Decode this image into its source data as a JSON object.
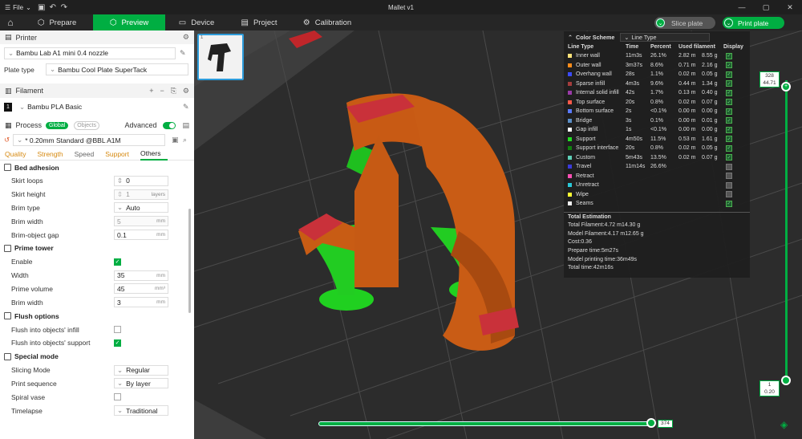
{
  "window": {
    "title": "Mallet v1",
    "menu_label": "File"
  },
  "tabs": [
    {
      "label": "Prepare",
      "icon": "cube-icon"
    },
    {
      "label": "Preview",
      "icon": "cube-icon",
      "active": true
    },
    {
      "label": "Device",
      "icon": "monitor-icon"
    },
    {
      "label": "Project",
      "icon": "project-icon"
    },
    {
      "label": "Calibration",
      "icon": "calibration-icon"
    }
  ],
  "actions": {
    "slice_label": "Slice plate",
    "print_label": "Print plate"
  },
  "printer": {
    "section_title": "Printer",
    "name": "Bambu Lab A1 mini 0.4 nozzle",
    "plate_type_label": "Plate type",
    "plate_type_value": "Bambu Cool Plate SuperTack"
  },
  "filament": {
    "section_title": "Filament",
    "slot": "1",
    "name": "Bambu PLA Basic"
  },
  "process": {
    "section_title": "Process",
    "global_label": "Global",
    "objects_label": "Objects",
    "advanced_label": "Advanced",
    "preset": "* 0.20mm Standard @BBL A1M",
    "categories": [
      "Quality",
      "Strength",
      "Speed",
      "Support",
      "Others"
    ]
  },
  "groups": {
    "bed_adhesion": "Bed adhesion",
    "prime_tower": "Prime tower",
    "flush": "Flush options",
    "special": "Special mode"
  },
  "options": {
    "skirt_loops": {
      "label": "Skirt loops",
      "value": "0"
    },
    "skirt_height": {
      "label": "Skirt height",
      "value": "1",
      "unit": "layers"
    },
    "brim_type": {
      "label": "Brim type",
      "value": "Auto"
    },
    "brim_width": {
      "label": "Brim width",
      "value": "5",
      "unit": "mm"
    },
    "brim_gap": {
      "label": "Brim-object gap",
      "value": "0.1",
      "unit": "mm"
    },
    "enable": {
      "label": "Enable",
      "checked": true
    },
    "width": {
      "label": "Width",
      "value": "35",
      "unit": "mm"
    },
    "prime_volume": {
      "label": "Prime volume",
      "value": "45",
      "unit": "mm³"
    },
    "pt_brim_width": {
      "label": "Brim width",
      "value": "3",
      "unit": "mm"
    },
    "flush_infill": {
      "label": "Flush into objects' infill",
      "checked": false
    },
    "flush_support": {
      "label": "Flush into objects' support",
      "checked": true
    },
    "slicing_mode": {
      "label": "Slicing Mode",
      "value": "Regular"
    },
    "print_sequence": {
      "label": "Print sequence",
      "value": "By layer"
    },
    "spiral_vase": {
      "label": "Spiral vase",
      "checked": false
    },
    "timelapse": {
      "label": "Timelapse",
      "value": "Traditional"
    }
  },
  "legend": {
    "title": "Color Scheme",
    "scheme": "Line Type",
    "headers": [
      "Line Type",
      "Time",
      "Percent",
      "Used filament",
      "Display"
    ],
    "rows": [
      {
        "name": "Inner wall",
        "color": "#ffe37a",
        "time": "11m3s",
        "percent": "26.1%",
        "len": "2.82 m",
        "wt": "8.55 g",
        "display": true
      },
      {
        "name": "Outer wall",
        "color": "#ff8c1a",
        "time": "3m37s",
        "percent": "8.6%",
        "len": "0.71 m",
        "wt": "2.16 g",
        "display": true
      },
      {
        "name": "Overhang wall",
        "color": "#3b4bff",
        "time": "28s",
        "percent": "1.1%",
        "len": "0.02 m",
        "wt": "0.05 g",
        "display": true
      },
      {
        "name": "Sparse infill",
        "color": "#a43c3c",
        "time": "4m3s",
        "percent": "9.6%",
        "len": "0.44 m",
        "wt": "1.34 g",
        "display": true
      },
      {
        "name": "Internal solid infill",
        "color": "#9a3aa8",
        "time": "42s",
        "percent": "1.7%",
        "len": "0.13 m",
        "wt": "0.40 g",
        "display": true
      },
      {
        "name": "Top surface",
        "color": "#ff5a4a",
        "time": "20s",
        "percent": "0.8%",
        "len": "0.02 m",
        "wt": "0.07 g",
        "display": true
      },
      {
        "name": "Bottom surface",
        "color": "#5a7aff",
        "time": "2s",
        "percent": "<0.1%",
        "len": "0.00 m",
        "wt": "0.00 g",
        "display": true
      },
      {
        "name": "Bridge",
        "color": "#5b8fc8",
        "time": "3s",
        "percent": "0.1%",
        "len": "0.00 m",
        "wt": "0.01 g",
        "display": true
      },
      {
        "name": "Gap infill",
        "color": "#ffffff",
        "time": "1s",
        "percent": "<0.1%",
        "len": "0.00 m",
        "wt": "0.00 g",
        "display": true
      },
      {
        "name": "Support",
        "color": "#22dd22",
        "time": "4m50s",
        "percent": "11.5%",
        "len": "0.53 m",
        "wt": "1.61 g",
        "display": true
      },
      {
        "name": "Support interface",
        "color": "#108010",
        "time": "20s",
        "percent": "0.8%",
        "len": "0.02 m",
        "wt": "0.05 g",
        "display": true
      },
      {
        "name": "Custom",
        "color": "#5fd0b8",
        "time": "5m43s",
        "percent": "13.5%",
        "len": "0.02 m",
        "wt": "0.07 g",
        "display": true
      },
      {
        "name": "Travel",
        "color": "#3a3adb",
        "time": "11m14s",
        "percent": "26.6%",
        "len": "",
        "wt": "",
        "display": false
      },
      {
        "name": "Retract",
        "color": "#ff4fb4",
        "time": "",
        "percent": "",
        "len": "",
        "wt": "",
        "display": false
      },
      {
        "name": "Unretract",
        "color": "#2ac8d8",
        "time": "",
        "percent": "",
        "len": "",
        "wt": "",
        "display": false
      },
      {
        "name": "Wipe",
        "color": "#ffff33",
        "time": "",
        "percent": "",
        "len": "",
        "wt": "",
        "display": false
      },
      {
        "name": "Seams",
        "color": "#f0f0f0",
        "time": "",
        "percent": "",
        "len": "",
        "wt": "",
        "display": true
      }
    ],
    "total_title": "Total Estimation",
    "estimates": [
      {
        "label": "Total Filament:",
        "a": "4.72 m",
        "b": "14.30 g"
      },
      {
        "label": "Model Filament:",
        "a": "4.17 m",
        "b": "12.65 g"
      },
      {
        "label": "Cost:",
        "a": "0.36",
        "b": ""
      },
      {
        "label": "Prepare time:",
        "a": "5m27s",
        "b": ""
      },
      {
        "label": "Model printing time:",
        "a": "36m49s",
        "b": ""
      },
      {
        "label": "Total time:",
        "a": "42m16s",
        "b": ""
      }
    ]
  },
  "slider": {
    "top_layer": "328",
    "top_height": "44.71",
    "bottom_layer": "1",
    "bottom_height": "0.20",
    "move_value": "374"
  }
}
